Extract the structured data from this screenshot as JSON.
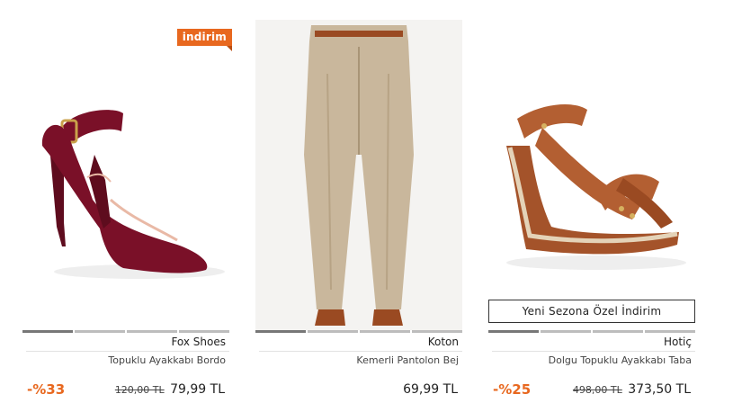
{
  "products": [
    {
      "badge": "indirim",
      "brand": "Fox Shoes",
      "name": "Topuklu Ayakkabı Bordo",
      "discount": "-%33",
      "old_price": "120,00 TL",
      "price": "79,99 TL",
      "image_icon": "burgundy-pump-shoe"
    },
    {
      "brand": "Koton",
      "name": "Kemerli Pantolon Bej",
      "price": "69,99 TL",
      "image_icon": "beige-trousers"
    },
    {
      "promo": "Yeni Sezona Özel İndirim",
      "brand": "Hotiç",
      "name": "Dolgu Topuklu Ayakkabı Taba",
      "discount": "-%25",
      "old_price": "498,00 TL",
      "price": "373,50 TL",
      "image_icon": "tan-wedge-sandal"
    }
  ],
  "colors": {
    "accent": "#e8681f",
    "burgundy": "#7a1028",
    "beige": "#c9b79c",
    "tan": "#a4532a"
  }
}
